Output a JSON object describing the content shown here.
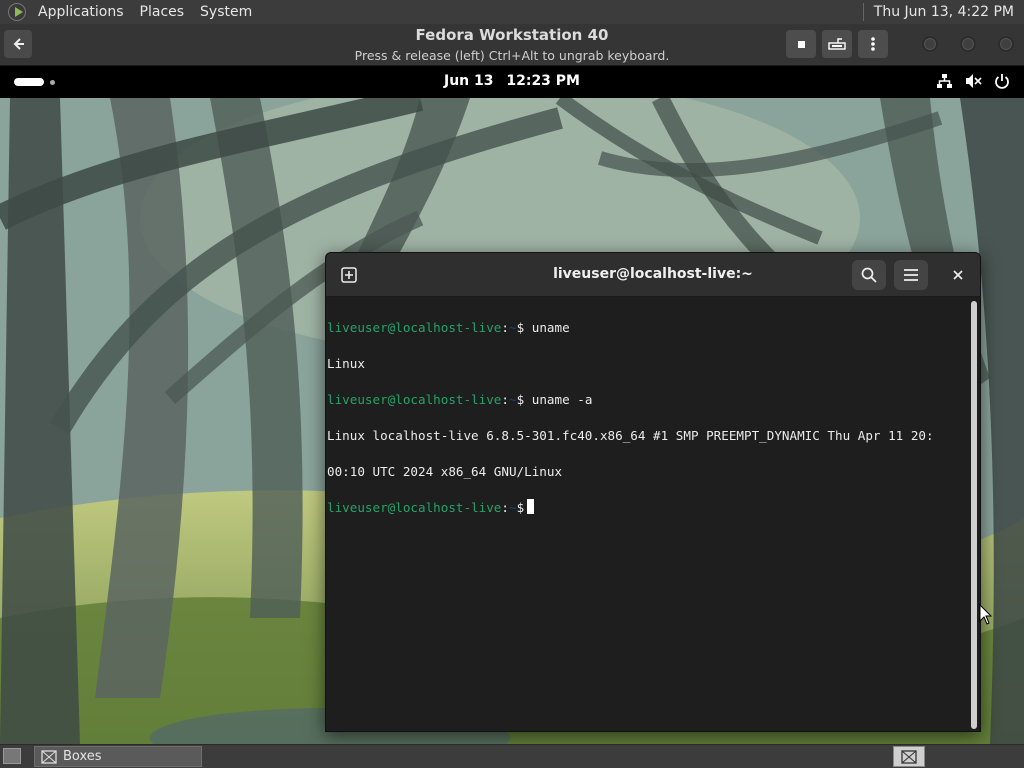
{
  "host_panel": {
    "menus": [
      "Applications",
      "Places",
      "System"
    ],
    "clock": "Thu Jun 13,  4:22 PM"
  },
  "boxes_window": {
    "title": "Fedora Workstation 40",
    "subtitle": "Press & release (left) Ctrl+Alt to ungrab keyboard.",
    "buttons": [
      "back-icon",
      "stop-icon",
      "keyboard-icon",
      "kebab-menu-icon"
    ]
  },
  "gnome_bar": {
    "date": "Jun 13",
    "time": "12:23 PM",
    "status_icons": [
      "network-icon",
      "volume-muted-icon",
      "power-icon"
    ]
  },
  "terminal": {
    "title": "liveuser@localhost-live:~",
    "lines": [
      {
        "user": "liveuser@localhost-live",
        "path": "~",
        "cmd": "uname"
      },
      {
        "output": "Linux"
      },
      {
        "user": "liveuser@localhost-live",
        "path": "~",
        "cmd": "uname -a"
      },
      {
        "output": "Linux localhost-live 6.8.5-301.fc40.x86_64 #1 SMP PREEMPT_DYNAMIC Thu Apr 11 20:"
      },
      {
        "output": "00:10 UTC 2024 x86_64 GNU/Linux"
      },
      {
        "user": "liveuser@localhost-live",
        "path": "~",
        "cmd": ""
      }
    ]
  },
  "taskbar": {
    "task_label": "Boxes"
  },
  "colors": {
    "prompt_user": "#26a269",
    "prompt_path": "#12488b",
    "terminal_bg": "#1e1e1e"
  }
}
